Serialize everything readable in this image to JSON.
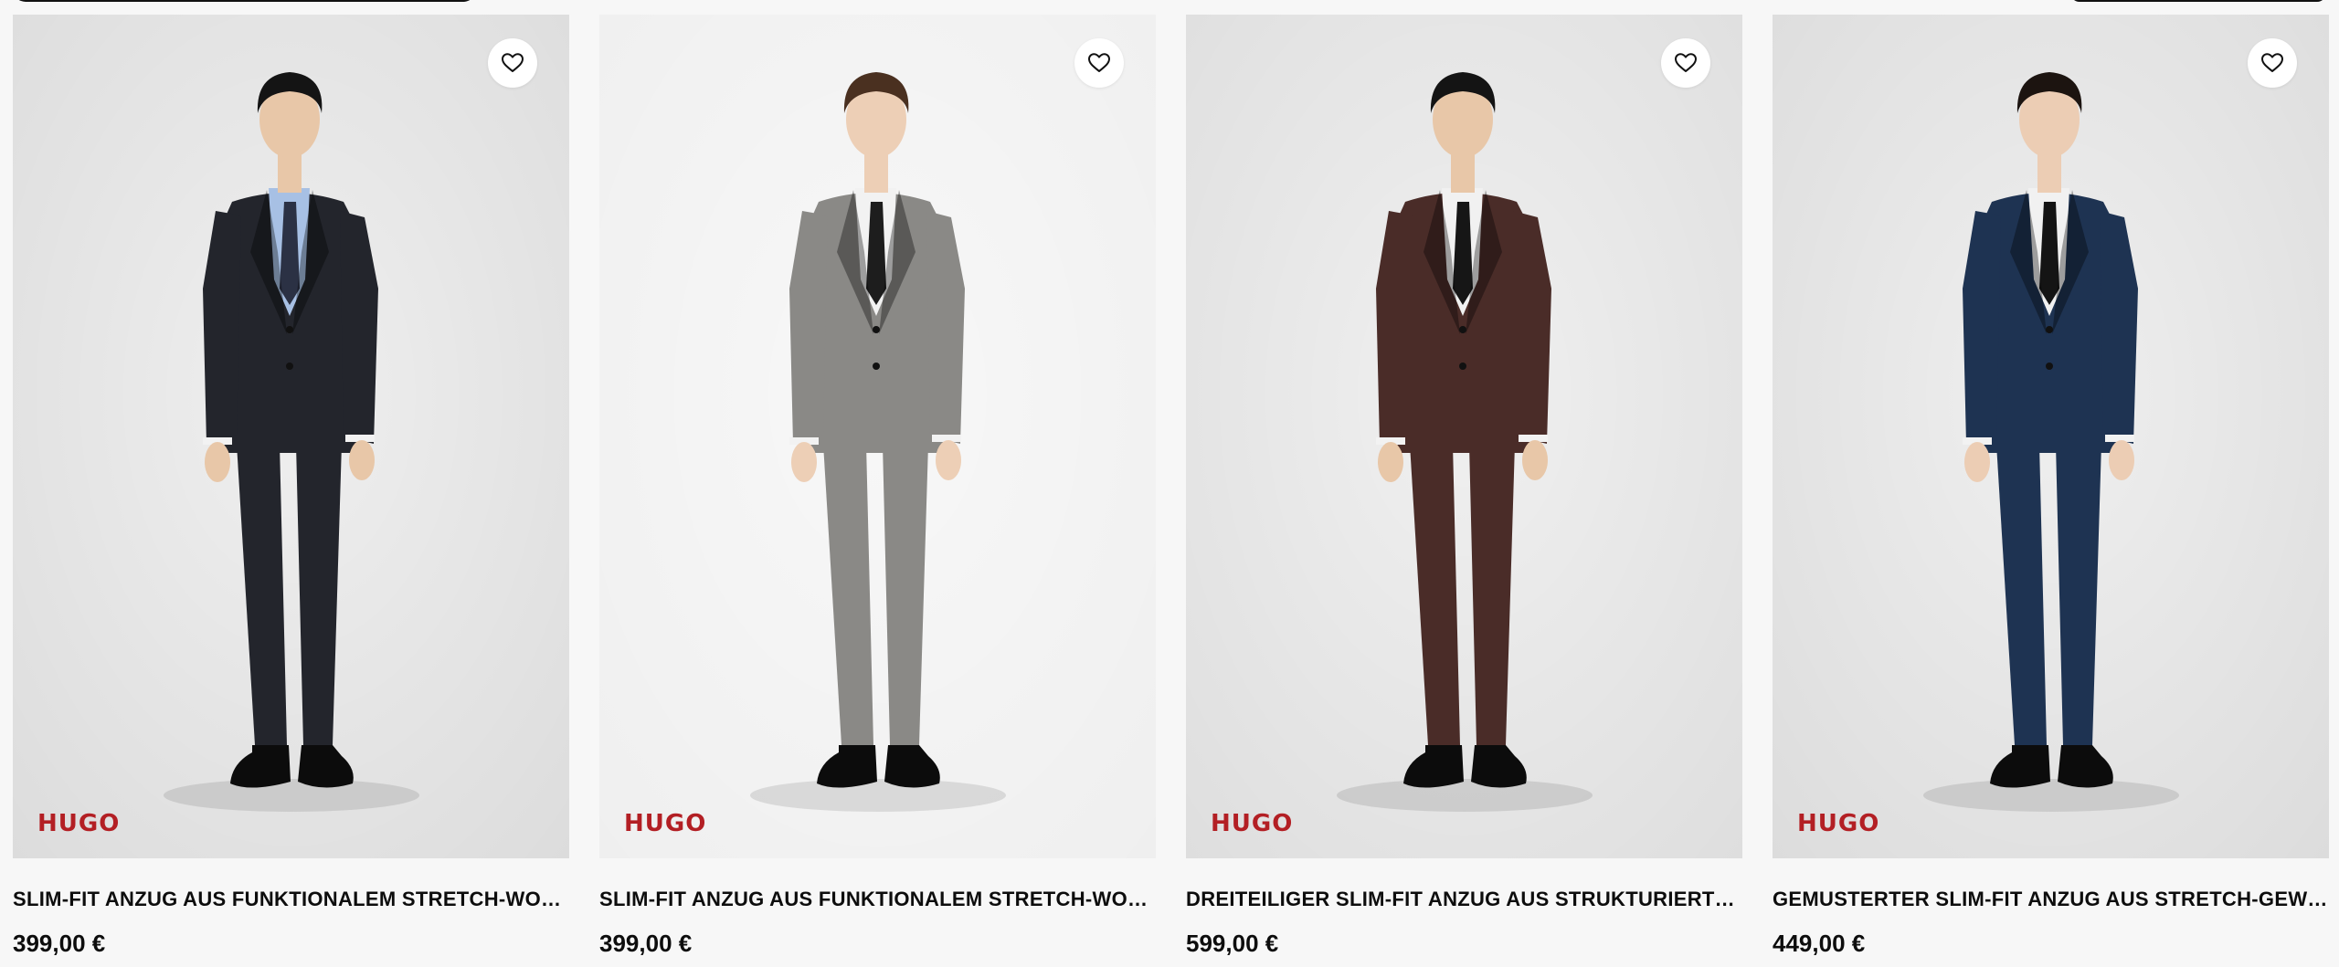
{
  "products": [
    {
      "brand": "HUGO",
      "name": "SLIM-FIT ANZUG AUS FUNKTIONALEM STRETCH-WOLL...",
      "price": "399,00 €",
      "image_bg": "#dcdcdc",
      "suit_color": "#23252c",
      "shirt_color": "#a7c0e4",
      "tie_color": "#2b3144",
      "hair_color": "#141414",
      "skin_color": "#e8c7a8"
    },
    {
      "brand": "HUGO",
      "name": "SLIM-FIT ANZUG AUS FUNKTIONALEM STRETCH-WOLL...",
      "price": "399,00 €",
      "image_bg": "#efefef",
      "suit_color": "#8a8986",
      "shirt_color": "#f2f2f2",
      "tie_color": "#1d1d1d",
      "hair_color": "#4a3020",
      "skin_color": "#edcfb6"
    },
    {
      "brand": "HUGO",
      "name": "DREITEILIGER SLIM-FIT ANZUG AUS STRUKTURIERTEM ...",
      "price": "599,00 €",
      "image_bg": "#dedede",
      "suit_color": "#4a2c28",
      "shirt_color": "#f1f1f1",
      "tie_color": "#161616",
      "hair_color": "#141414",
      "skin_color": "#e8c7a8"
    },
    {
      "brand": "HUGO",
      "name": "GEMUSTERTER SLIM-FIT ANZUG AUS STRETCH-GEWEBE",
      "price": "449,00 €",
      "image_bg": "#dcdcdc",
      "suit_color": "#1e3352",
      "shirt_color": "#f1f1f1",
      "tie_color": "#141414",
      "hair_color": "#1c1410",
      "skin_color": "#eccdb4"
    }
  ],
  "icons": {
    "favorite": "heart-outline-icon"
  }
}
